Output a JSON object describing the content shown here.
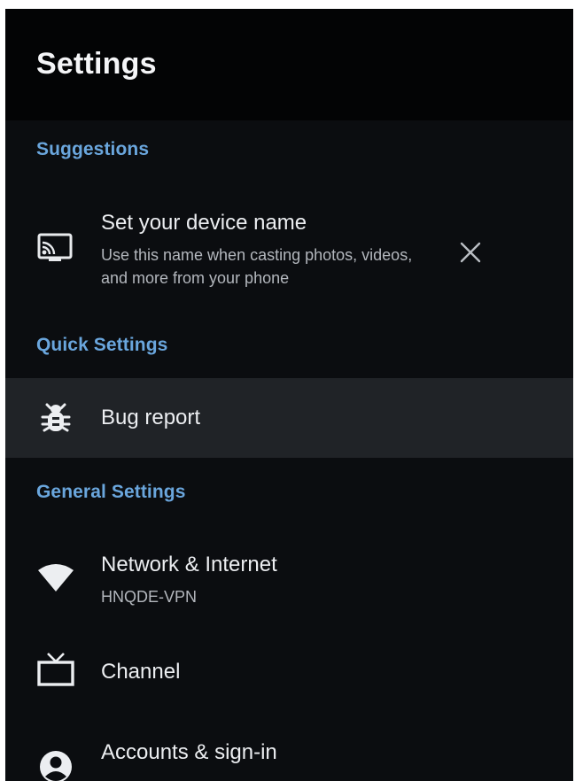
{
  "header": {
    "title": "Settings"
  },
  "sections": {
    "suggestions": {
      "label": "Suggestions",
      "items": [
        {
          "title": "Set your device name",
          "subtitle_line1": "Use this name when casting photos, videos,",
          "subtitle_line2": "and more from your phone",
          "icon": "cast-icon",
          "dismiss_icon": "close-icon"
        }
      ]
    },
    "quick_settings": {
      "label": "Quick Settings",
      "items": [
        {
          "title": "Bug report",
          "icon": "bug-icon"
        }
      ]
    },
    "general_settings": {
      "label": "General Settings",
      "items": [
        {
          "title": "Network & Internet",
          "subtitle": "HNQDE-VPN",
          "icon": "wifi-icon"
        },
        {
          "title": "Channel",
          "icon": "tv-icon"
        },
        {
          "title": "Accounts & sign-in",
          "icon": "account-circle-icon"
        }
      ]
    }
  },
  "colors": {
    "background": "#0b0d10",
    "header_background": "#030405",
    "focused_row": "#202327",
    "section_label": "#6aa6dd",
    "primary_text": "#eceef1",
    "secondary_text": "#b3b7bd"
  }
}
